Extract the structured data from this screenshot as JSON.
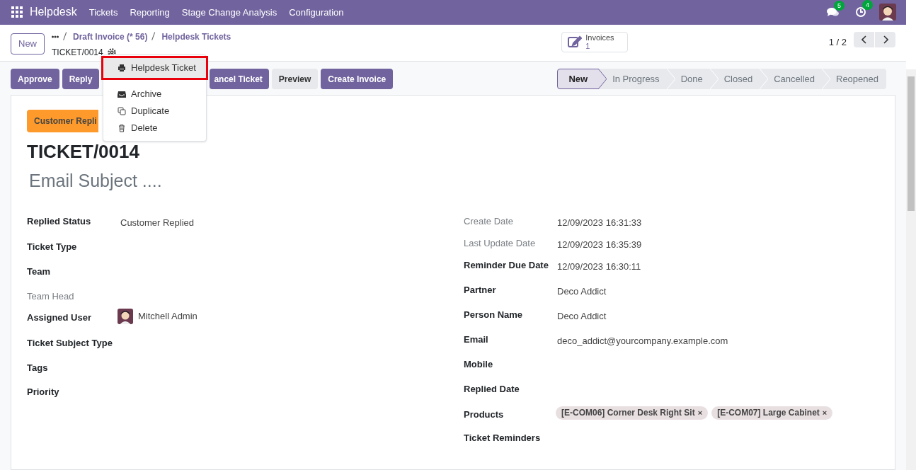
{
  "navbar": {
    "app": "Helpdesk",
    "menu": [
      "Tickets",
      "Reporting",
      "Stage Change Analysis",
      "Configuration"
    ],
    "chat_badge": "5",
    "activity_badge": "4"
  },
  "control_panel": {
    "new_button": "New",
    "breadcrumbs": [
      "Draft Invoice (* 56)",
      "Helpdesk Tickets"
    ],
    "record": "TICKET/0014",
    "smart_button": {
      "label": "Invoices",
      "count": "1"
    },
    "pager": "1 / 2"
  },
  "actions": [
    {
      "label": "Approve",
      "kind": "primary"
    },
    {
      "label": "Reply",
      "kind": "primary"
    },
    {
      "label": "ancel Ticket",
      "kind": "primary"
    },
    {
      "label": "Preview",
      "kind": "secondary"
    },
    {
      "label": "Create Invoice",
      "kind": "primary"
    }
  ],
  "dropdown": {
    "items": [
      {
        "label": "Helpdesk Ticket",
        "kind": "print",
        "highlighted": true
      },
      {
        "label": "Archive",
        "kind": "archive",
        "highlighted": false
      },
      {
        "label": "Duplicate",
        "kind": "duplicate",
        "highlighted": false
      },
      {
        "label": "Delete",
        "kind": "delete",
        "highlighted": false
      }
    ]
  },
  "stages": [
    {
      "label": "New",
      "selected": true
    },
    {
      "label": "In Progress",
      "selected": false
    },
    {
      "label": "Done",
      "selected": false
    },
    {
      "label": "Closed",
      "selected": false
    },
    {
      "label": "Cancelled",
      "selected": false
    },
    {
      "label": "Reopened",
      "selected": false
    }
  ],
  "form": {
    "badge": "Customer Repli",
    "title": "TICKET/0014",
    "subject_placeholder": "Email Subject ....",
    "left_fields": [
      {
        "label": "Replied Status",
        "muted": false,
        "kind": "text",
        "value": "Customer Replied"
      },
      {
        "label": "Ticket Type",
        "muted": false,
        "kind": "empty"
      },
      {
        "label": "Team",
        "muted": false,
        "kind": "empty"
      },
      {
        "label": "Team Head",
        "muted": true,
        "kind": "empty"
      },
      {
        "label": "Assigned User",
        "muted": false,
        "kind": "user",
        "value": "Mitchell Admin"
      },
      {
        "label": "Ticket Subject Type",
        "muted": false,
        "kind": "empty"
      },
      {
        "label": "Tags",
        "muted": false,
        "kind": "empty"
      },
      {
        "label": "Priority",
        "muted": false,
        "kind": "empty"
      }
    ],
    "right_fields": [
      {
        "label": "Create Date",
        "muted": true,
        "kind": "text",
        "value": "12/09/2023 16:31:33"
      },
      {
        "label": "Last Update Date",
        "muted": true,
        "kind": "text",
        "value": "12/09/2023 16:35:39"
      },
      {
        "label": "Reminder Due Date",
        "muted": false,
        "kind": "text",
        "value": "12/09/2023 16:30:11"
      },
      {
        "label": "Partner",
        "muted": false,
        "kind": "text",
        "value": "Deco Addict"
      },
      {
        "label": "Person Name",
        "muted": false,
        "kind": "text",
        "value": "Deco Addict"
      },
      {
        "label": "Email",
        "muted": false,
        "kind": "text",
        "value": "deco_addict@yourcompany.example.com"
      },
      {
        "label": "Mobile",
        "muted": false,
        "kind": "empty"
      },
      {
        "label": "Replied Date",
        "muted": false,
        "kind": "empty"
      },
      {
        "label": "Products",
        "muted": false,
        "kind": "tags",
        "tags": [
          {
            "label": "[E-COM06] Corner Desk Right Sit",
            "remove": "×"
          },
          {
            "label": "[E-COM07] Large Cabinet",
            "remove": "×"
          }
        ]
      },
      {
        "label": "Ticket Reminders",
        "muted": false,
        "kind": "empty"
      }
    ]
  }
}
